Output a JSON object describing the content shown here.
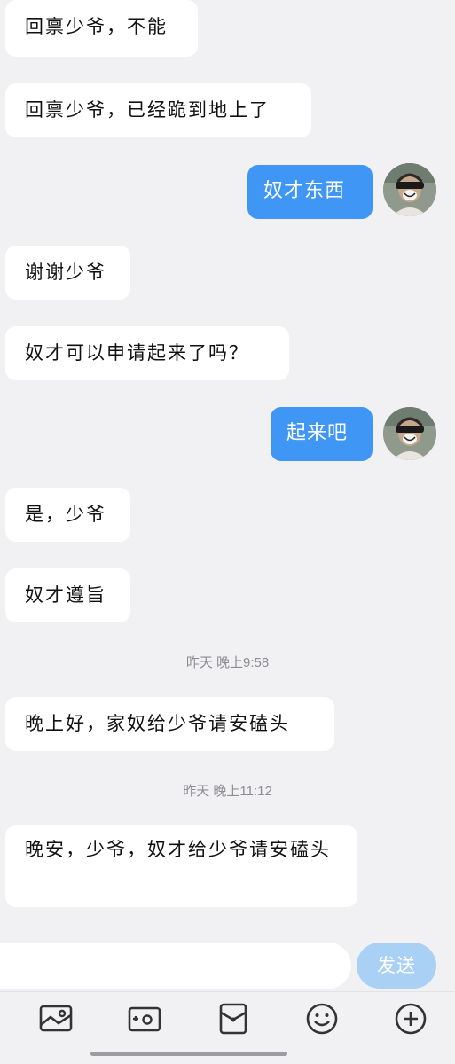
{
  "messages": [
    {
      "text": "回禀少爷，不能"
    },
    {
      "text": "回禀少爷，已经跪到地上了"
    },
    {
      "text": "奴才东西"
    },
    {
      "text": "谢谢少爷"
    },
    {
      "text": "奴才可以申请起来了吗？"
    },
    {
      "text": "起来吧"
    },
    {
      "text": "是，少爷"
    },
    {
      "text": "奴才遵旨"
    },
    {
      "text": "晚上好，家奴给少爷请安磕头"
    },
    {
      "text": "晚安，少爷，奴才给少爷请安磕头"
    }
  ],
  "timestamps": [
    "昨天 晚上9:58",
    "昨天 晚上11:12"
  ],
  "input": {
    "value": "",
    "placeholder": ""
  },
  "send": {
    "label": "发送"
  },
  "toolbar": {
    "icons": [
      "image-icon",
      "camera-icon",
      "red-packet-icon",
      "emoji-icon",
      "plus-icon"
    ]
  },
  "colors": {
    "background": "#f1f1f3",
    "outgoing_bubble": "#3f96f5",
    "incoming_bubble": "#ffffff",
    "send_button": "#a9d0f5"
  }
}
